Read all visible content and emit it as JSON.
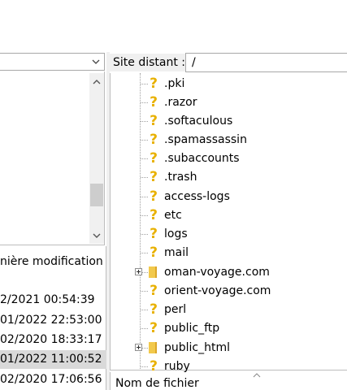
{
  "left_pane": {
    "column_header": "nière modification",
    "rows": [
      {
        "date": "2/2021 00:54:39",
        "selected": false
      },
      {
        "date": "01/2022 22:53:00",
        "selected": false
      },
      {
        "date": "02/2020 18:33:17",
        "selected": false
      },
      {
        "date": "01/2022 11:00:52",
        "selected": true
      },
      {
        "date": "02/2020 17:06:56",
        "selected": false
      }
    ]
  },
  "right_pane": {
    "site_label": "Site distant :",
    "site_path": "/",
    "tree": [
      {
        "label": ".pki",
        "type": "unknown"
      },
      {
        "label": ".razor",
        "type": "unknown"
      },
      {
        "label": ".softaculous",
        "type": "unknown"
      },
      {
        "label": ".spamassassin",
        "type": "unknown"
      },
      {
        "label": ".subaccounts",
        "type": "unknown"
      },
      {
        "label": ".trash",
        "type": "unknown"
      },
      {
        "label": "access-logs",
        "type": "unknown"
      },
      {
        "label": "etc",
        "type": "unknown"
      },
      {
        "label": "logs",
        "type": "unknown"
      },
      {
        "label": "mail",
        "type": "unknown"
      },
      {
        "label": "oman-voyage.com",
        "type": "folder"
      },
      {
        "label": "orient-voyage.com",
        "type": "unknown"
      },
      {
        "label": "perl",
        "type": "unknown"
      },
      {
        "label": "public_ftp",
        "type": "unknown"
      },
      {
        "label": "public_html",
        "type": "folder"
      },
      {
        "label": "ruby",
        "type": "unknown"
      }
    ],
    "file_list_header": "Nom de fichier"
  },
  "icons": {
    "unknown_dir": "question-mark-icon",
    "folder": "folder-icon",
    "expand": "plus-box-icon",
    "dropdown": "chevron-down-icon",
    "scroll_up": "chevron-up-icon",
    "scroll_down": "chevron-down-icon",
    "sort": "sort-ascending-icon"
  },
  "colors": {
    "question_icon": "#e8b100",
    "folder_icon": "#f2c94c",
    "selected_row": "#d9d9d9"
  }
}
